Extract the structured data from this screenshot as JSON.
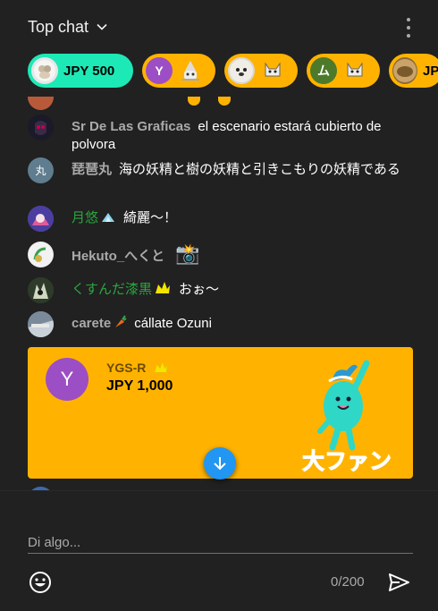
{
  "header": {
    "title": "Top chat"
  },
  "ticker": [
    {
      "amount": "JPY 500",
      "style": "teal"
    },
    {
      "initial": "Y",
      "avatar_color": "#9c4ec4"
    },
    {
      "avatar_color": "#d8d8d8"
    },
    {
      "initial": "ム",
      "avatar_color": "#4c7a2a"
    },
    {
      "amount": "JP",
      "avatar_color": "#8a6a3a"
    }
  ],
  "messages": [
    {
      "author": "Sr De Las Graficas",
      "text": "el escenario estará cubierto de polvora",
      "author_style": "gray",
      "avatar_color": "#2b1a3a"
    },
    {
      "author": "琵琶丸",
      "text": "海の妖精と樹の妖精と引きこもりの妖精である",
      "author_style": "gray",
      "avatar_initial": "丸",
      "avatar_color": "#5f7d8e"
    },
    {
      "author": "月悠",
      "text": "綺麗～！",
      "author_style": "green",
      "avatar_color": "#5b4fa8"
    },
    {
      "author": "Hekuto_へくと",
      "text": "📸",
      "author_style": "gray",
      "avatar_color": "#e8e8e8"
    },
    {
      "author": "くすんだ漆黒",
      "text": "おぉ～",
      "author_style": "green",
      "avatar_color": "#3a4a2a"
    },
    {
      "author": "carete",
      "text": "cállate Ozuni",
      "author_style": "gray",
      "avatar_color": "#6a7a8a"
    }
  ],
  "paid_sticker": {
    "author": "YGS-R",
    "amount": "JPY 1,000",
    "avatar_initial": "Y",
    "sticker_text": "大ファン"
  },
  "input": {
    "placeholder": "Di algo...",
    "value": "",
    "counter": "0/200"
  },
  "colors": {
    "panel": "#212121",
    "accent_blue": "#2196f3",
    "paid_yellow": "#ffb300",
    "teal": "#1de9b6",
    "member_green": "#2ba640"
  }
}
